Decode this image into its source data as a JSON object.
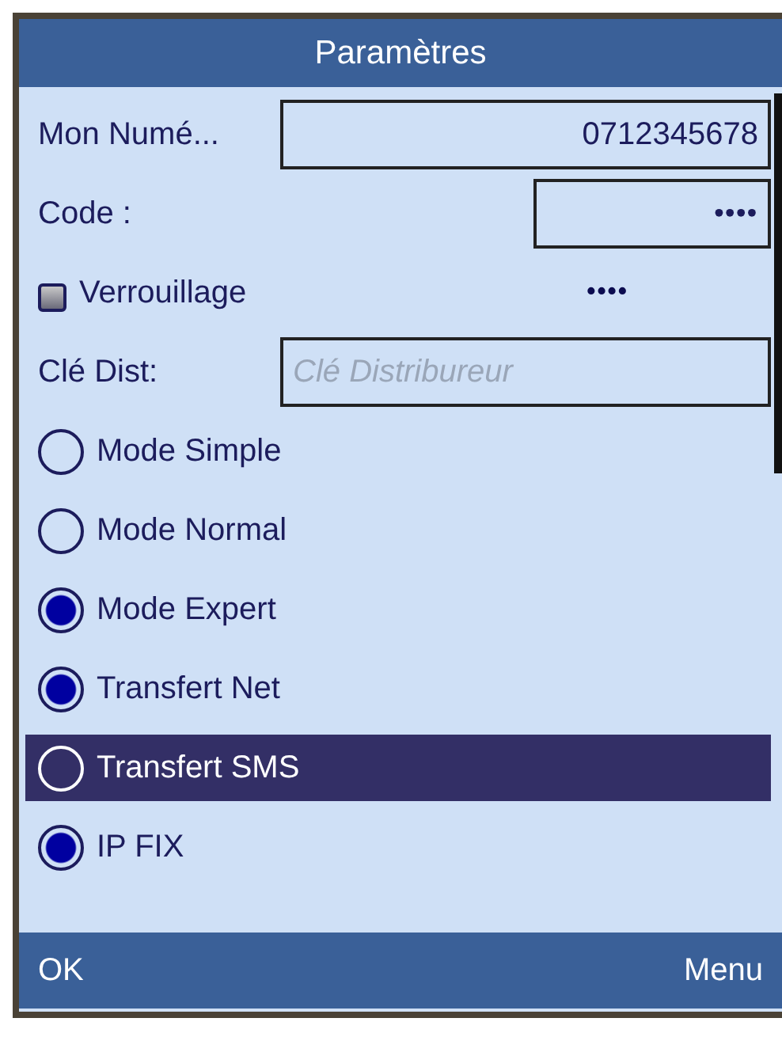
{
  "window": {
    "title": "Paramètres"
  },
  "fields": [
    {
      "kind": "field",
      "label": "Mon Numé...",
      "value": "0712345678"
    },
    {
      "kind": "short-field",
      "label": "Code :",
      "value": "••••"
    },
    {
      "kind": "checkbox",
      "label": "Verrouillage",
      "checked": false,
      "value": "••••"
    },
    {
      "kind": "field",
      "label": "Clé Dist:",
      "placeholder": "Clé Distribureur"
    }
  ],
  "options": [
    {
      "label": "Mode Simple",
      "checked": false,
      "highlighted": false
    },
    {
      "label": "Mode Normal",
      "checked": false,
      "highlighted": false
    },
    {
      "label": "Mode Expert",
      "checked": true,
      "highlighted": false
    },
    {
      "label": "Transfert Net",
      "checked": true,
      "highlighted": false
    },
    {
      "label": "Transfert SMS",
      "checked": false,
      "highlighted": true
    },
    {
      "label": "IP FIX",
      "checked": true,
      "highlighted": false
    }
  ],
  "softkeys": {
    "left": "OK",
    "right": "Menu"
  }
}
